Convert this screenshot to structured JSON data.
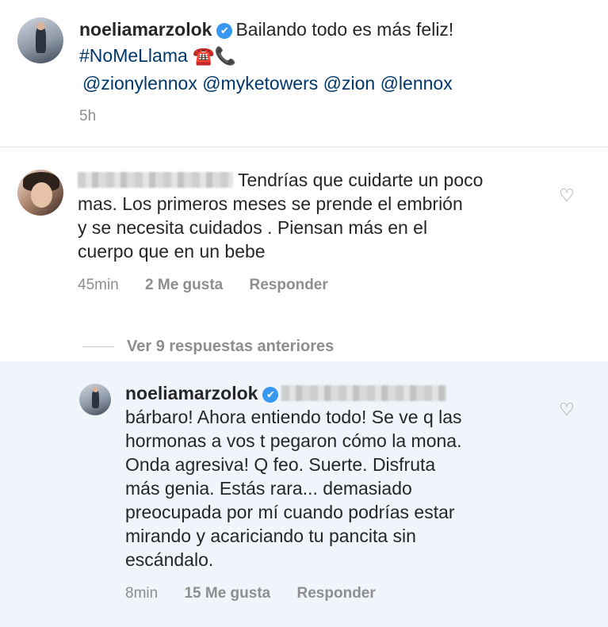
{
  "post": {
    "username": "noeliamarzolok",
    "verified_icon": "✔",
    "caption_line1": "Bailando todo es más feliz!",
    "hashtag": "#NoMeLlama",
    "emoji1": "☎️",
    "emoji2": "📞",
    "mentions": "@zionylennox @myketowers @zion @lennox",
    "time": "5h"
  },
  "comment": {
    "text_line1": "Tendrías que cuidarte un poco",
    "text_line2": "mas. Los primeros meses se prende el embrión",
    "text_line3": "y se necesita cuidados . Piensan más en el",
    "text_line4": "cuerpo que en un bebe",
    "time": "45min",
    "likes": "2 Me gusta",
    "reply": "Responder"
  },
  "view_replies": "Ver 9 respuestas anteriores",
  "reply": {
    "username": "noeliamarzolok",
    "verified_icon": "✔",
    "line1": "bárbaro! Ahora entiendo todo! Se ve q las",
    "line2": "hormonas a vos t pegaron cómo la mona.",
    "line3": "Onda agresiva! Q feo. Suerte.  Disfruta",
    "line4": "más genia. Estás rara... demasiado",
    "line5": "preocupada por mí cuando podrías estar",
    "line6": "mirando y acariciando tu pancita sin",
    "line7": "escándalo.",
    "time": "8min",
    "likes": "15 Me gusta",
    "reply": "Responder"
  },
  "icons": {
    "like": "heart-outline-icon"
  },
  "colors": {
    "verified": "#3897f0",
    "link": "#00376b",
    "highlight": "#eff5fb",
    "meta": "#8e8e8e"
  }
}
